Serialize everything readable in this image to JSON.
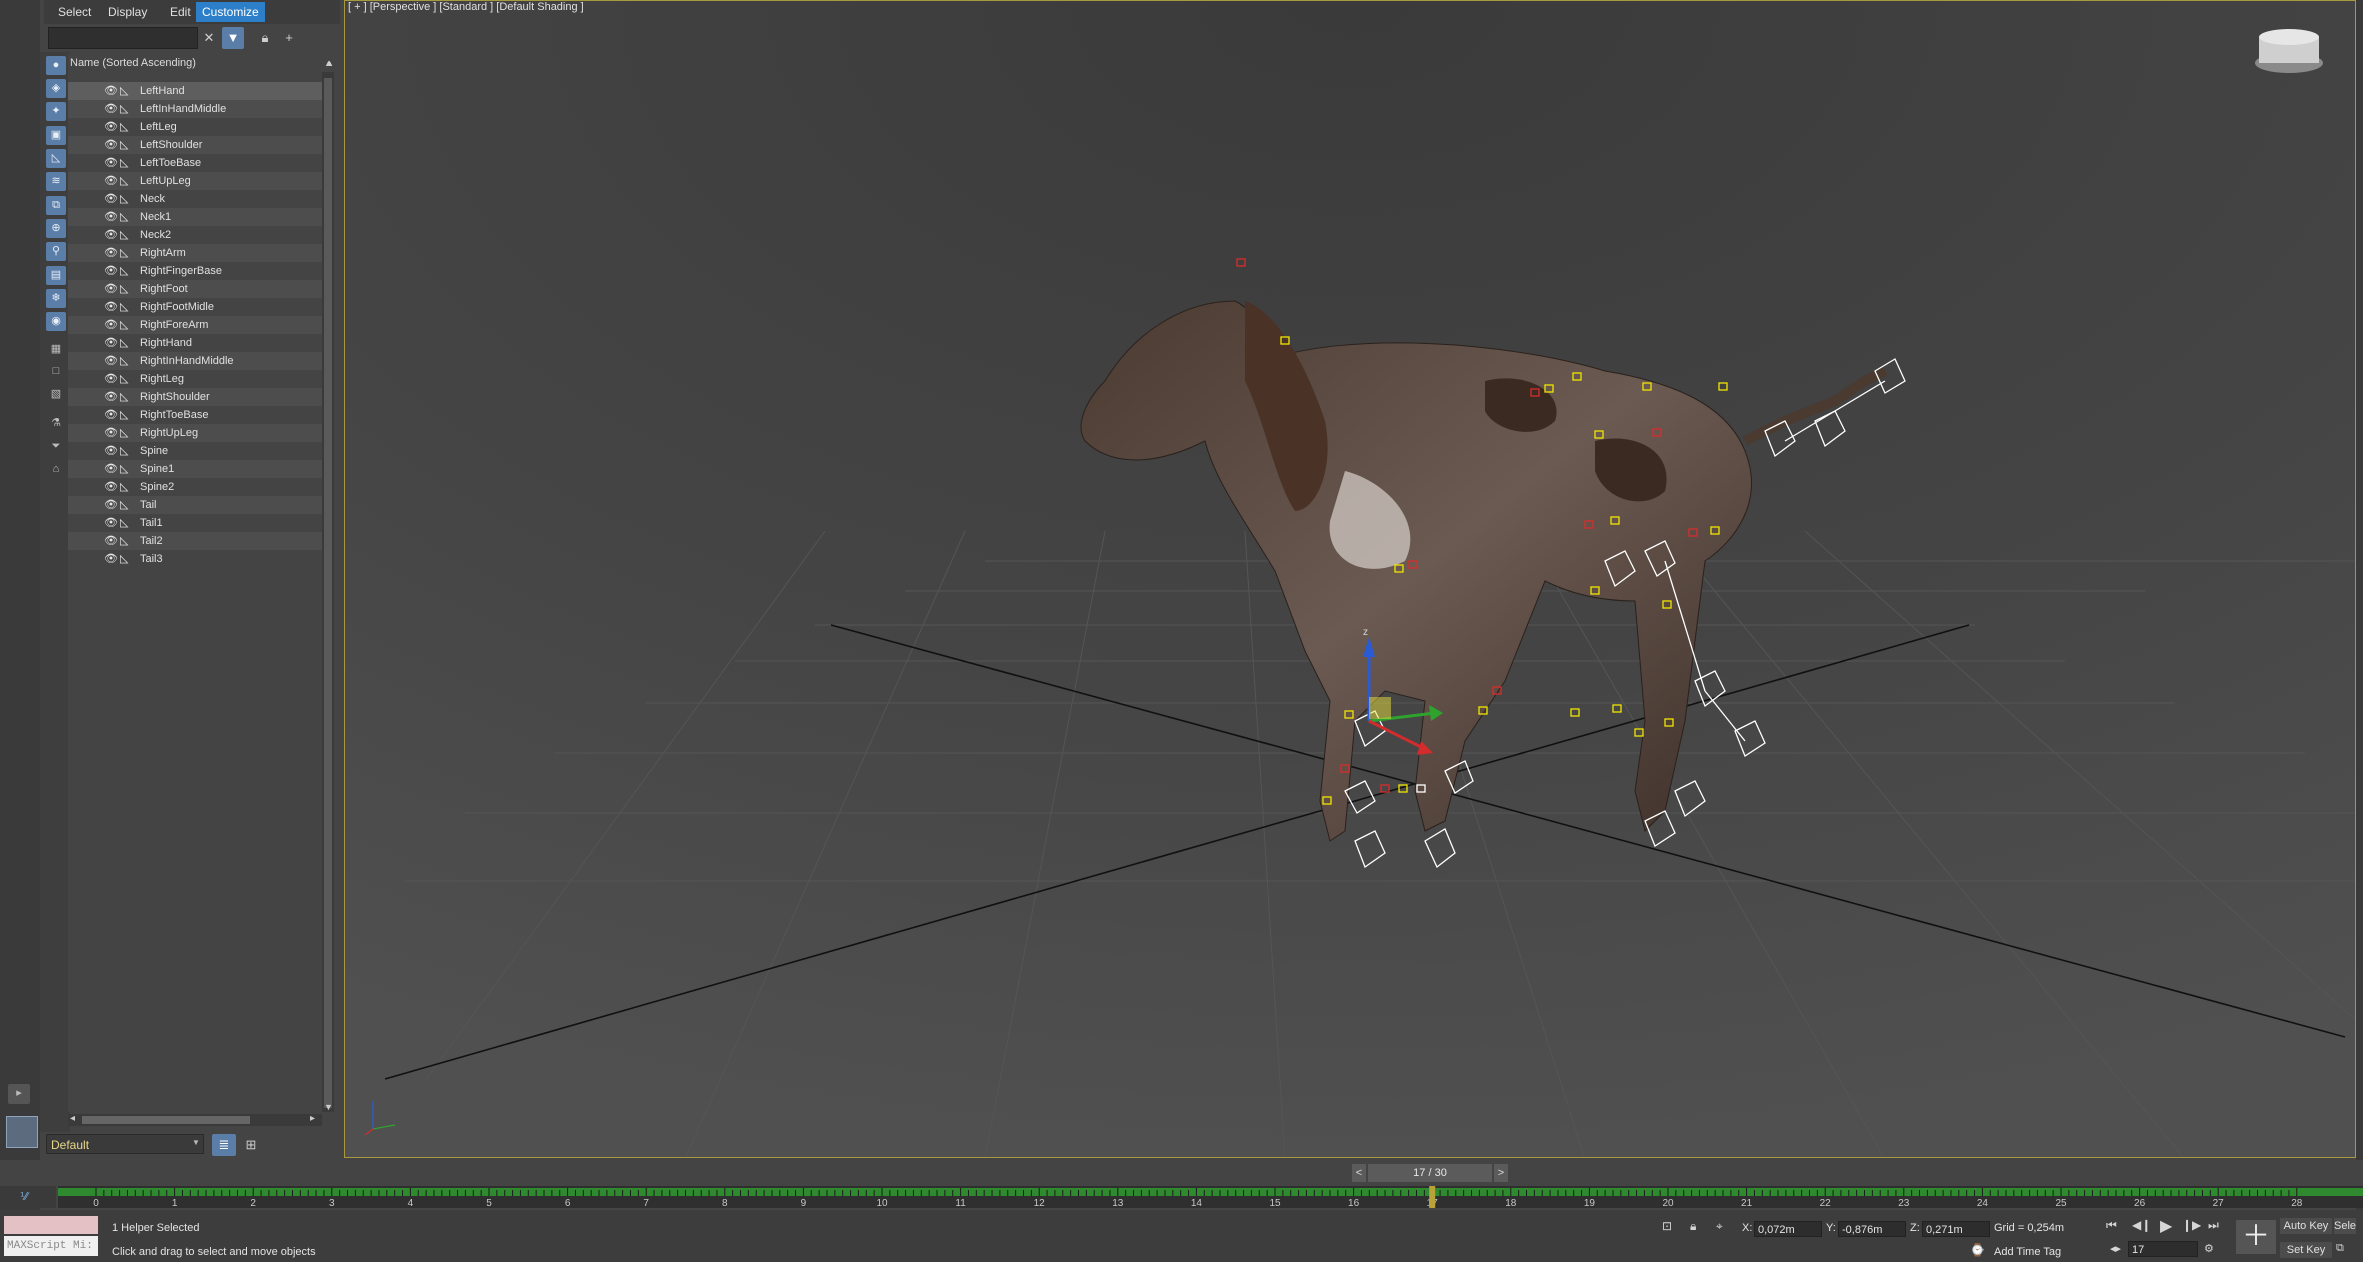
{
  "menu": {
    "items": [
      {
        "label": "Select"
      },
      {
        "label": "Display"
      },
      {
        "label": "Edit"
      },
      {
        "label": "Customize",
        "active": true
      }
    ]
  },
  "explorer": {
    "column_header": "Name (Sorted Ascending)",
    "rows": [
      "LeftHand",
      "LeftInHandMiddle",
      "LeftLeg",
      "LeftShoulder",
      "LeftToeBase",
      "LeftUpLeg",
      "Neck",
      "Neck1",
      "Neck2",
      "RightArm",
      "RightFingerBase",
      "RightFoot",
      "RightFootMidle",
      "RightForeArm",
      "RightHand",
      "RightInHandMiddle",
      "RightLeg",
      "RightShoulder",
      "RightToeBase",
      "RightUpLeg",
      "Spine",
      "Spine1",
      "Spine2",
      "Tail",
      "Tail1",
      "Tail2",
      "Tail3"
    ],
    "selected_row": "LeftHand",
    "layer": "Default"
  },
  "viewport": {
    "label": "[ + ] [Perspective ] [Standard ] [Default Shading ]",
    "border_color": "#a89a3c"
  },
  "timeline": {
    "frame_display": "17 / 30",
    "prev": "<",
    "next": ">",
    "tick_labels": [
      "0",
      "1",
      "2",
      "3",
      "4",
      "5",
      "6",
      "7",
      "8",
      "9",
      "10",
      "11",
      "12",
      "13",
      "14",
      "15",
      "16",
      "17",
      "18",
      "19",
      "20",
      "21",
      "22",
      "23",
      "24",
      "25",
      "26",
      "27",
      "28"
    ],
    "current_frame": 17
  },
  "status": {
    "maxscript_label": "MAXScript Mi:",
    "selection": "1 Helper Selected",
    "prompt": "Click and drag to select and move objects",
    "x_label": "X:",
    "x_value": "0,072m",
    "y_label": "Y:",
    "y_value": "-0,876m",
    "z_label": "Z:",
    "z_value": "0,271m",
    "grid": "Grid = 0,254m",
    "add_time_tag": "Add Time Tag",
    "auto_key": "Auto Key",
    "set_key": "Set Key",
    "frame_field": "17",
    "selected_short": "Selec"
  },
  "colors": {
    "accent": "#2d7fc9",
    "timeline_green": "#2f8a2f",
    "current_frame_marker": "#b8a23a",
    "helper_yellow": "#f2e600",
    "helper_red": "#d92c2c"
  }
}
